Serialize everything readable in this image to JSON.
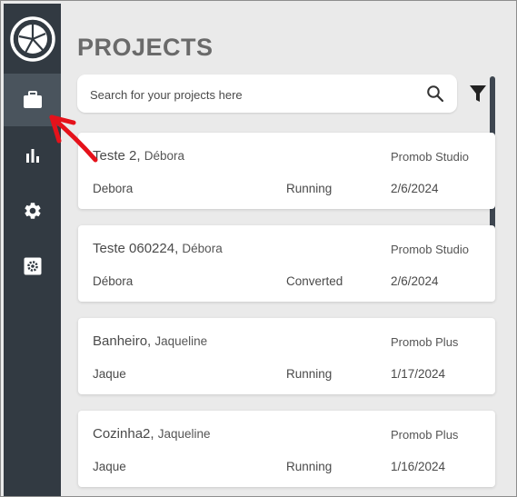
{
  "header": {
    "title": "PROJECTS"
  },
  "search": {
    "placeholder": "Search for your projects here",
    "value": ""
  },
  "icons": {
    "logo": "pie-logo-icon",
    "search": "search-icon",
    "filter": "filter-icon",
    "projects": "briefcase-icon",
    "reports": "bar-chart-icon",
    "settings": "gear-icon",
    "admin": "gear-box-icon"
  },
  "colors": {
    "sidebar": "#323a42",
    "sidebar_active": "#4a545d",
    "background": "#eaeaea",
    "annotation_arrow": "#e5121b"
  },
  "projects": [
    {
      "name": "Teste 2",
      "owner": "Débora",
      "software": "Promob Studio",
      "user": "Debora",
      "status": "Running",
      "date": "2/6/2024"
    },
    {
      "name": "Teste 060224",
      "owner": "Débora",
      "software": "Promob Studio",
      "user": "Débora",
      "status": "Converted",
      "date": "2/6/2024"
    },
    {
      "name": "Banheiro",
      "owner": "Jaqueline",
      "software": "Promob Plus",
      "user": "Jaque",
      "status": "Running",
      "date": "1/17/2024"
    },
    {
      "name": "Cozinha2",
      "owner": "Jaqueline",
      "software": "Promob Plus",
      "user": "Jaque",
      "status": "Running",
      "date": "1/16/2024"
    }
  ]
}
